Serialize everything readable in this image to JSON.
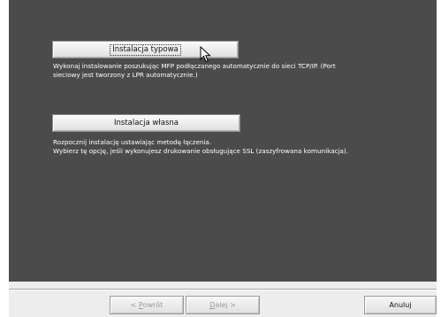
{
  "options": {
    "typical": {
      "button_label": "Instalacja typowa",
      "description_line1": "Wykonaj instalowanie poszukując MFP podłączanego automatycznie do sieci  TCP/IP.  (Port",
      "description_line2": "sieciowy jest tworzony z  LPR automatycznie.)"
    },
    "custom": {
      "button_label": "Instalacja własna",
      "description_line1": "Rozpocznij  instalację ustawiając metodę łączenia.",
      "description_line2": "Wybierz tę opcję, jeśli wykonujesz drukowanie obsługujące SSL (zaszyfrowana komunikacja)."
    }
  },
  "footer": {
    "back": {
      "accel": "P",
      "rest": "owrót",
      "prefix": "< "
    },
    "next": {
      "accel": "D",
      "rest": "alej >"
    },
    "cancel": "Anuluj"
  },
  "colors": {
    "panel": "#4b4b4b",
    "footer": "#ededed",
    "disabled_text": "#9a9a9a"
  },
  "icons": {
    "cursor": "arrow-cursor-icon"
  }
}
